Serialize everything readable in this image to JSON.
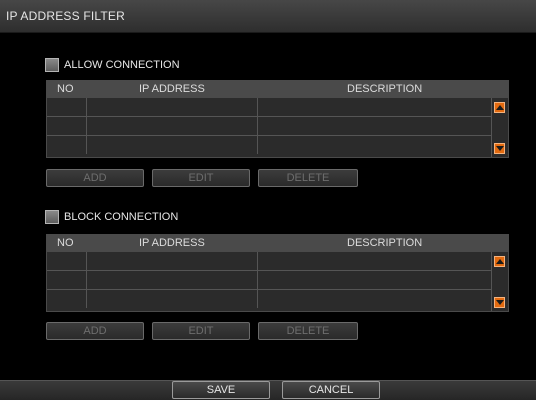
{
  "window": {
    "title": "IP ADDRESS FILTER"
  },
  "allow": {
    "label": "ALLOW CONNECTION",
    "columns": {
      "no": "NO",
      "ip": "IP ADDRESS",
      "description": "DESCRIPTION"
    },
    "buttons": {
      "add": "ADD",
      "edit": "EDIT",
      "delete": "DELETE"
    }
  },
  "block": {
    "label": "BLOCK CONNECTION",
    "columns": {
      "no": "NO",
      "ip": "IP ADDRESS",
      "description": "DESCRIPTION"
    },
    "buttons": {
      "add": "ADD",
      "edit": "EDIT",
      "delete": "DELETE"
    }
  },
  "footer": {
    "save": "SAVE",
    "cancel": "CANCEL"
  },
  "colors": {
    "accent": "#e36a0f",
    "background": "#000000",
    "header": "#4a4a4a"
  }
}
